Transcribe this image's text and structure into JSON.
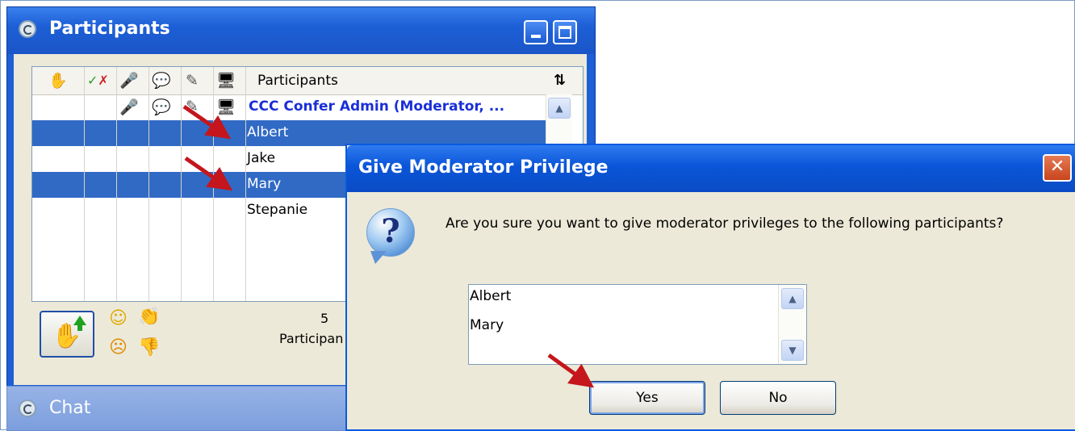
{
  "participants_window": {
    "title": "Participants",
    "column_icons": [
      "hand-icon",
      "check-x-icon",
      "microphone-icon",
      "speech-bubble-icon",
      "pencil-icon",
      "monitor-icon"
    ],
    "column_header": "Participants",
    "sort_icon": "⇅",
    "rows": [
      {
        "name": "CCC Confer Admin (Moderator, ...",
        "selected": false
      },
      {
        "name": "Albert",
        "selected": true
      },
      {
        "name": "Jake",
        "selected": false
      },
      {
        "name": "Mary",
        "selected": true
      },
      {
        "name": "Stepanie",
        "selected": false
      }
    ],
    "count": "5",
    "count_label": "Participan",
    "emoticons": [
      "smile-icon",
      "clap-icon",
      "frown-icon",
      "thumbs-down-icon"
    ]
  },
  "chat_window": {
    "title": "Chat"
  },
  "dialog": {
    "title": "Give Moderator Privilege",
    "close_label": "✕",
    "question_glyph": "?",
    "message": "Are you sure you want to give moderator privileges to the following participants?",
    "list_items": [
      "Albert",
      "Mary"
    ],
    "yes_label": "Yes",
    "no_label": "No"
  },
  "colors": {
    "titlebar_blue": "#1d5fd6",
    "selection_blue": "#316ac5",
    "admin_text": "#1a2fd8",
    "arrow_red": "#c4161c",
    "close_red": "#c8451e"
  }
}
